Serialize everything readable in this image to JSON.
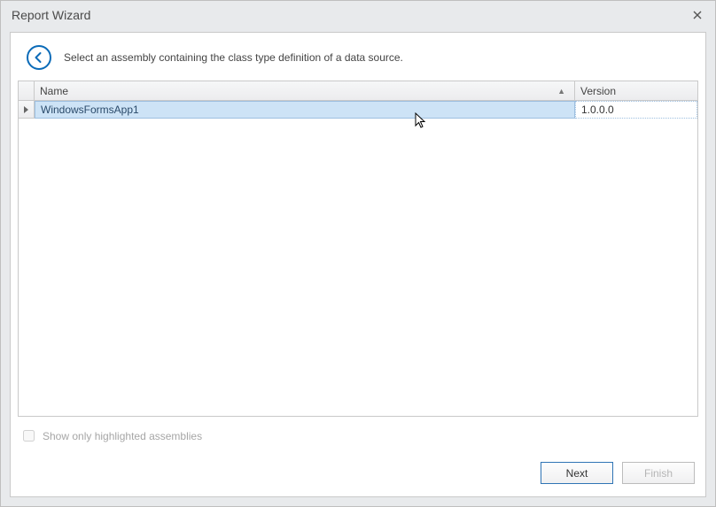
{
  "window": {
    "title": "Report Wizard"
  },
  "header": {
    "instruction": "Select an assembly containing the class type definition of a data source."
  },
  "grid": {
    "columns": {
      "name": "Name",
      "version": "Version"
    },
    "rows": [
      {
        "name": "WindowsFormsApp1",
        "version": "1.0.0.0",
        "selected": true
      }
    ]
  },
  "options": {
    "showHighlightedLabel": "Show only highlighted assemblies",
    "showHighlightedChecked": false
  },
  "buttons": {
    "next": "Next",
    "finish": "Finish"
  }
}
